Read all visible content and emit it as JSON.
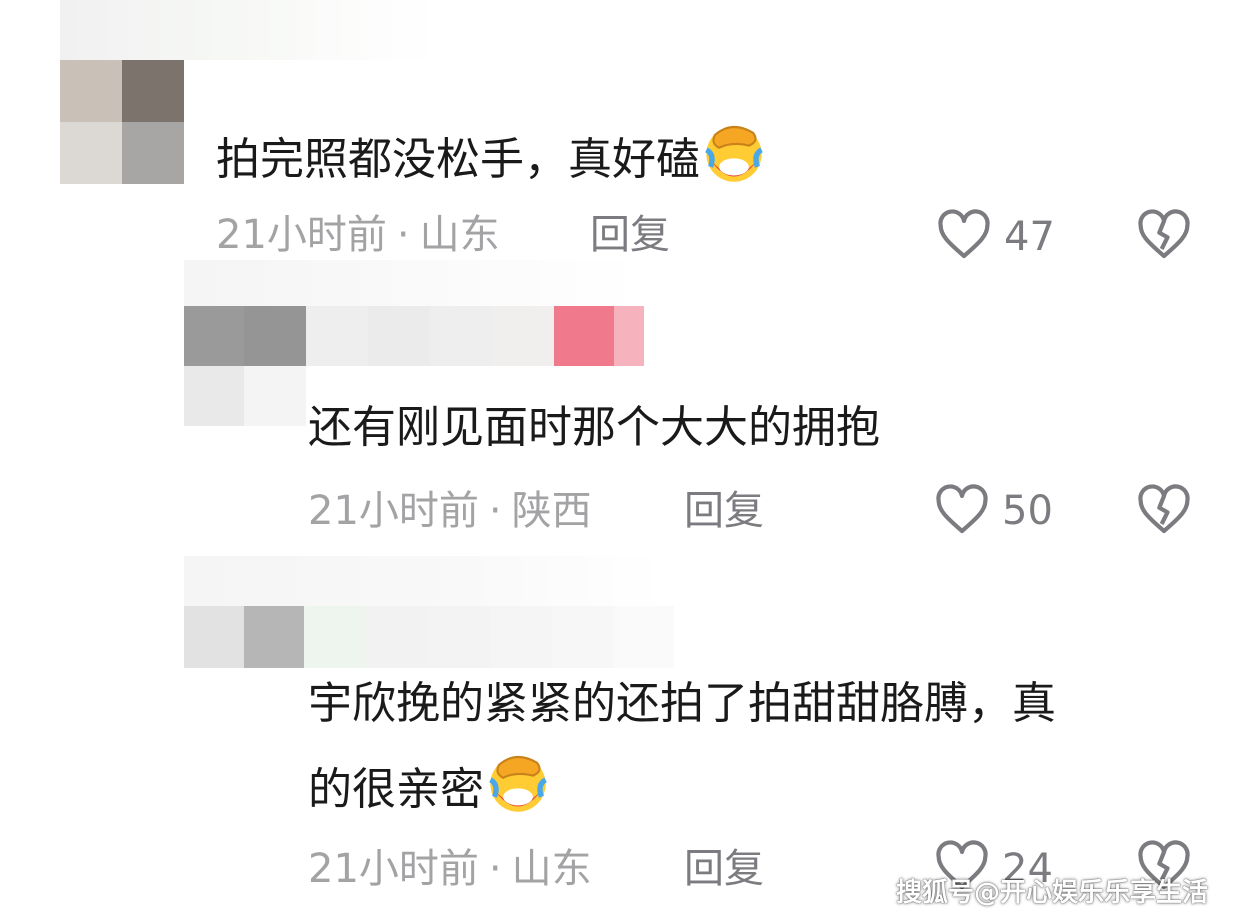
{
  "comments": [
    {
      "text": "拍完照都没松手，真好磕",
      "emoji": "face-with-tears-of-joy-palm-emoji",
      "time": "21小时前",
      "location": "山东",
      "reply_label": "回复",
      "likes": "47"
    },
    {
      "text": "还有刚见面时那个大大的拥抱",
      "time": "21小时前",
      "location": "陕西",
      "reply_label": "回复",
      "likes": "50"
    },
    {
      "text_line1": "宇欣挽的紧紧的还拍了拍甜甜胳膊，真",
      "text_line2": "的很亲密",
      "emoji": "face-with-tears-of-joy-palm-emoji",
      "time": "21小时前",
      "location": "山东",
      "reply_label": "回复",
      "likes": "24"
    }
  ],
  "separator": "·",
  "watermark": "搜狐号@开心娱乐乐享生活",
  "colors": {
    "text": "#1a1a1a",
    "meta": "#a3a3a6",
    "icon": "#7c7c80"
  }
}
